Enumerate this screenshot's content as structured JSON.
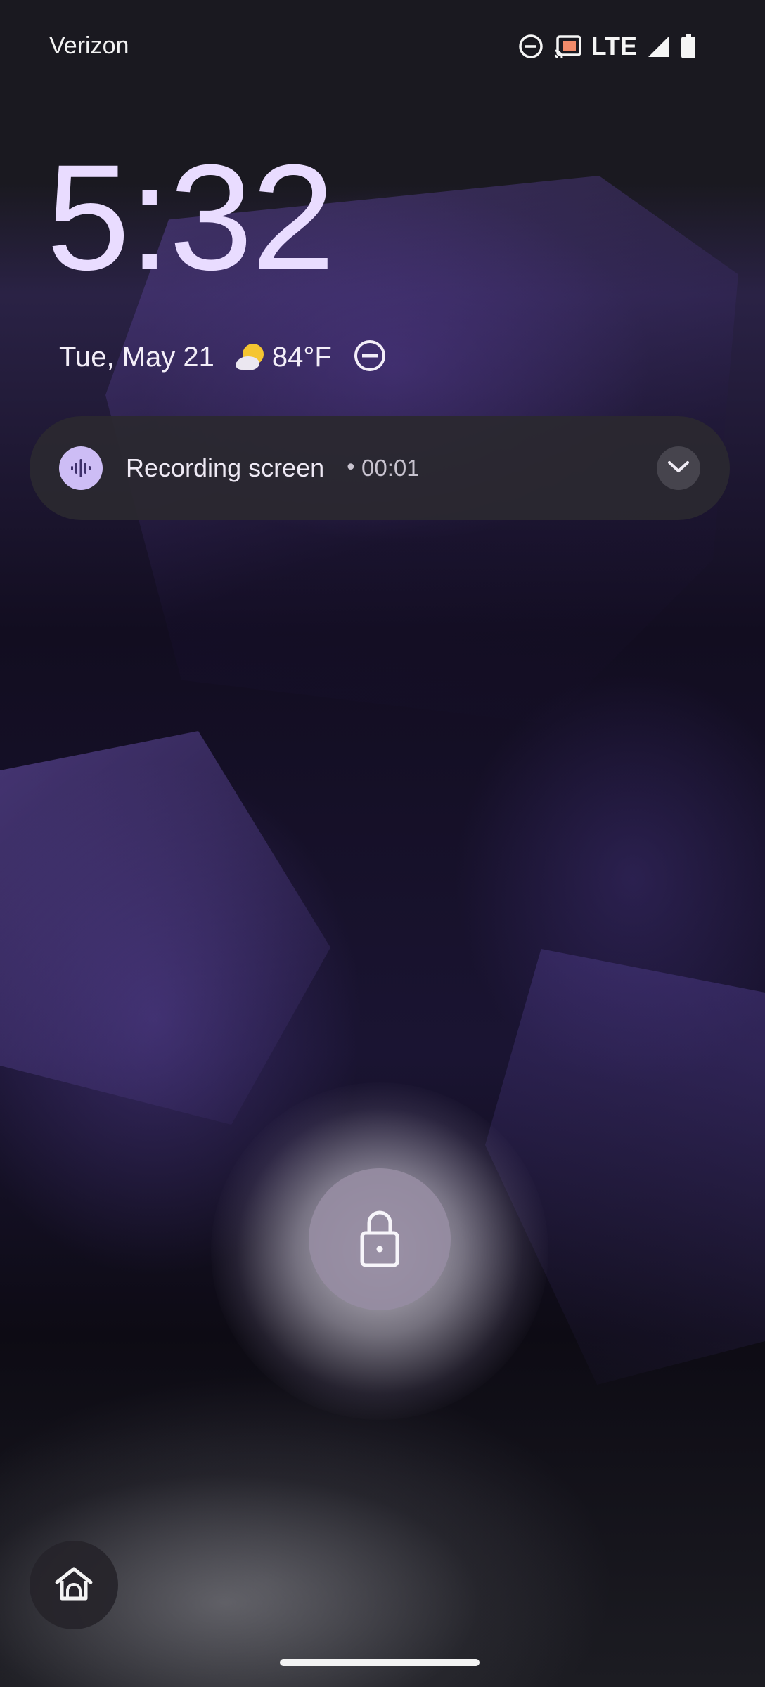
{
  "status_bar": {
    "carrier": "Verizon",
    "network": "LTE",
    "icons": [
      "do-not-disturb-icon",
      "cast-icon",
      "signal-icon",
      "battery-icon"
    ]
  },
  "lock_screen": {
    "time": "5:32",
    "date": "Tue, May 21",
    "weather": {
      "icon": "partly-sunny-icon",
      "temperature": "84°F"
    },
    "status_icon": "do-not-disturb-icon"
  },
  "notification": {
    "icon": "sound-wave-icon",
    "title": "Recording screen",
    "separator": "•",
    "elapsed": "00:01",
    "expand_icon": "chevron-down-icon"
  },
  "controls": {
    "unlock_icon": "lock-icon",
    "shortcut_icon": "home-icon"
  },
  "colors": {
    "clock": "#e9dcff",
    "notification_bg": "#2a2830",
    "recording_accent": "#cdbdf5",
    "lock_button": "#968ca2"
  }
}
